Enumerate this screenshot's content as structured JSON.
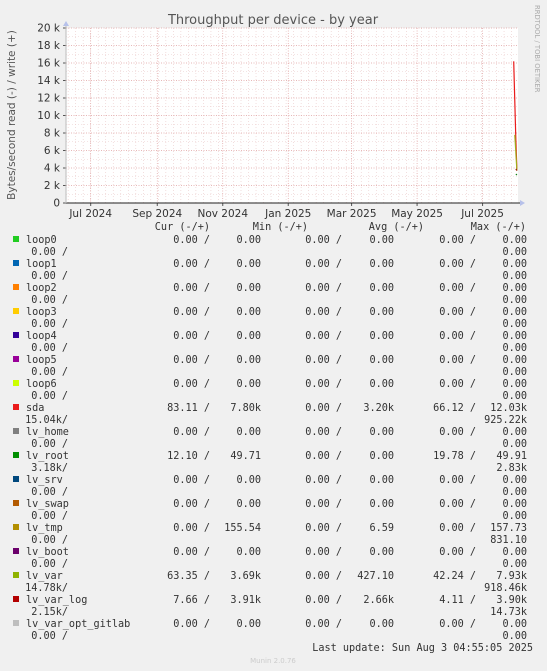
{
  "chart_data": {
    "type": "line",
    "title": "Throughput per device - by year",
    "ylabel": "Bytes/second read (-) / write (+)",
    "side_label": "RRDTOOL / TOBI OETIKER",
    "ylim": [
      0,
      20000
    ],
    "y_ticks": [
      {
        "v": 0,
        "label": "0"
      },
      {
        "v": 2000,
        "label": "2 k"
      },
      {
        "v": 4000,
        "label": "4 k"
      },
      {
        "v": 6000,
        "label": "6 k"
      },
      {
        "v": 8000,
        "label": "8 k"
      },
      {
        "v": 10000,
        "label": "10 k"
      },
      {
        "v": 12000,
        "label": "12 k"
      },
      {
        "v": 14000,
        "label": "14 k"
      },
      {
        "v": 16000,
        "label": "16 k"
      },
      {
        "v": 18000,
        "label": "18 k"
      },
      {
        "v": 20000,
        "label": "20 k"
      }
    ],
    "x_range": [
      "2024-06-08",
      "2025-08-03"
    ],
    "x_ticks": [
      {
        "date": "2024-07-01",
        "label": "Jul 2024"
      },
      {
        "date": "2024-09-01",
        "label": "Sep 2024"
      },
      {
        "date": "2024-11-01",
        "label": "Nov 2024"
      },
      {
        "date": "2025-01-01",
        "label": "Jan 2025"
      },
      {
        "date": "2025-03-01",
        "label": "Mar 2025"
      },
      {
        "date": "2025-05-01",
        "label": "May 2025"
      },
      {
        "date": "2025-07-01",
        "label": "Jul 2025"
      }
    ],
    "grid": true,
    "series": [
      {
        "name": "sda",
        "color": "#EA1B1B",
        "points": [
          {
            "x": "2025-07-30",
            "y": 16200
          },
          {
            "x": "2025-08-01",
            "y": 7000
          },
          {
            "x": "2025-08-02",
            "y": 3900
          }
        ]
      },
      {
        "name": "lv_var",
        "color": "#9FAF1A",
        "points": [
          {
            "x": "2025-07-31",
            "y": 7800
          },
          {
            "x": "2025-08-02",
            "y": 3700
          }
        ]
      },
      {
        "name": "lv_root",
        "color": "#0D7F0D",
        "points": [
          {
            "x": "2025-08-01",
            "y": 3300
          },
          {
            "x": "2025-08-02",
            "y": 3200
          }
        ]
      },
      {
        "name": "lv_var_log",
        "color": "#A10D0D",
        "points": [
          {
            "x": "2025-08-01",
            "y": 3900
          },
          {
            "x": "2025-08-02",
            "y": 3700
          }
        ]
      }
    ]
  },
  "legend": {
    "headers": [
      "Cur (-/+)",
      "Min (-/+)",
      "Avg (-/+)",
      "Max (-/+)"
    ],
    "rows": [
      {
        "name": "loop0",
        "color": "#22CC22",
        "line1": [
          "0.00 /",
          "0.00",
          "0.00 /",
          "0.00",
          "0.00 /",
          "0.00"
        ],
        "line2": [
          "0.00 /",
          "0.00"
        ]
      },
      {
        "name": "loop1",
        "color": "#0066B3",
        "line1": [
          "0.00 /",
          "0.00",
          "0.00 /",
          "0.00",
          "0.00 /",
          "0.00"
        ],
        "line2": [
          "0.00 /",
          "0.00"
        ]
      },
      {
        "name": "loop2",
        "color": "#FF8000",
        "line1": [
          "0.00 /",
          "0.00",
          "0.00 /",
          "0.00",
          "0.00 /",
          "0.00"
        ],
        "line2": [
          "0.00 /",
          "0.00"
        ]
      },
      {
        "name": "loop3",
        "color": "#FFCC00",
        "line1": [
          "0.00 /",
          "0.00",
          "0.00 /",
          "0.00",
          "0.00 /",
          "0.00"
        ],
        "line2": [
          "0.00 /",
          "0.00"
        ]
      },
      {
        "name": "loop4",
        "color": "#330099",
        "line1": [
          "0.00 /",
          "0.00",
          "0.00 /",
          "0.00",
          "0.00 /",
          "0.00"
        ],
        "line2": [
          "0.00 /",
          "0.00"
        ]
      },
      {
        "name": "loop5",
        "color": "#990099",
        "line1": [
          "0.00 /",
          "0.00",
          "0.00 /",
          "0.00",
          "0.00 /",
          "0.00"
        ],
        "line2": [
          "0.00 /",
          "0.00"
        ]
      },
      {
        "name": "loop6",
        "color": "#CCFF00",
        "line1": [
          "0.00 /",
          "0.00",
          "0.00 /",
          "0.00",
          "0.00 /",
          "0.00"
        ],
        "line2": [
          "0.00 /",
          "0.00"
        ]
      },
      {
        "name": "sda",
        "color": "#EA1B1B",
        "line1": [
          "83.11 /",
          "7.80k",
          "0.00 /",
          "3.20k",
          "66.12 /",
          "12.03k"
        ],
        "line2": [
          "15.04k/",
          "925.22k"
        ]
      },
      {
        "name": "lv_home",
        "color": "#808080",
        "line1": [
          "0.00 /",
          "0.00",
          "0.00 /",
          "0.00",
          "0.00 /",
          "0.00"
        ],
        "line2": [
          "0.00 /",
          "0.00"
        ]
      },
      {
        "name": "lv_root",
        "color": "#008F00",
        "line1": [
          "12.10 /",
          "49.71",
          "0.00 /",
          "0.00",
          "19.78 /",
          "49.91"
        ],
        "line2": [
          "3.18k/",
          "2.83k"
        ]
      },
      {
        "name": "lv_srv",
        "color": "#00487D",
        "line1": [
          "0.00 /",
          "0.00",
          "0.00 /",
          "0.00",
          "0.00 /",
          "0.00"
        ],
        "line2": [
          "0.00 /",
          "0.00"
        ]
      },
      {
        "name": "lv_swap",
        "color": "#B35A00",
        "line1": [
          "0.00 /",
          "0.00",
          "0.00 /",
          "0.00",
          "0.00 /",
          "0.00"
        ],
        "line2": [
          "0.00 /",
          "0.00"
        ]
      },
      {
        "name": "lv_tmp",
        "color": "#B38F00",
        "line1": [
          "0.00 /",
          "155.54",
          "0.00 /",
          "6.59",
          "0.00 /",
          "157.73"
        ],
        "line2": [
          "0.00 /",
          "831.10"
        ]
      },
      {
        "name": "lv_boot",
        "color": "#6B006B",
        "line1": [
          "0.00 /",
          "0.00",
          "0.00 /",
          "0.00",
          "0.00 /",
          "0.00"
        ],
        "line2": [
          "0.00 /",
          "0.00"
        ]
      },
      {
        "name": "lv_var",
        "color": "#8FB300",
        "line1": [
          "63.35 /",
          "3.69k",
          "0.00 /",
          "427.10",
          "42.24 /",
          "7.93k"
        ],
        "line2": [
          "14.78k/",
          "918.46k"
        ]
      },
      {
        "name": "lv_var_log",
        "color": "#B30000",
        "line1": [
          "7.66 /",
          "3.91k",
          "0.00 /",
          "2.66k",
          "4.11 /",
          "3.90k"
        ],
        "line2": [
          "2.15k/",
          "14.73k"
        ]
      },
      {
        "name": "lv_var_opt_gitlab",
        "color": "#BEBEBE",
        "line1": [
          "0.00 /",
          "0.00",
          "0.00 /",
          "0.00",
          "0.00 /",
          "0.00"
        ],
        "line2": [
          "0.00 /",
          "0.00"
        ]
      }
    ]
  },
  "footer": {
    "last_update": "Last update: Sun Aug  3 04:55:05 2025",
    "munin": "Munin 2.0.76"
  }
}
